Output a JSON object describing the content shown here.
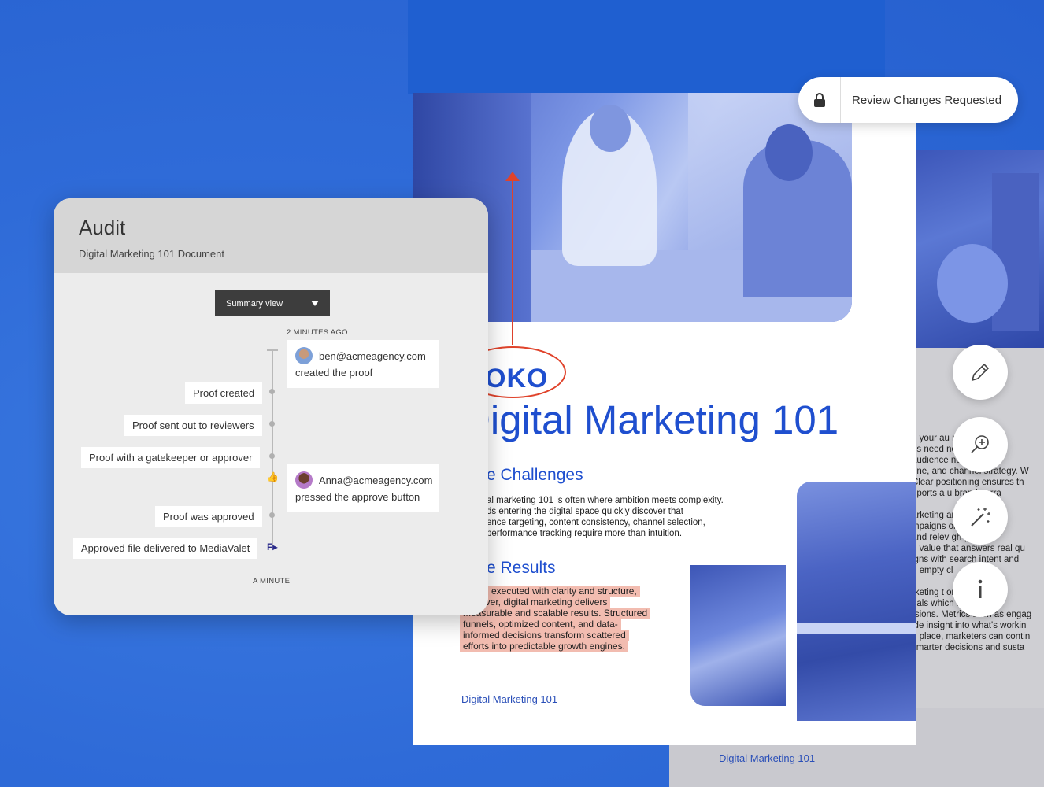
{
  "status": {
    "label": "Review Changes Requested"
  },
  "document": {
    "logo_text": "OKO",
    "title": "Digital Marketing 101",
    "challenges_heading": "e Challenges",
    "challenges_lines": [
      "al marketing 101 is often where ambition meets complexity.",
      "ds entering the digital space quickly discover that",
      "ence targeting, content consistency, channel selection,",
      "performance tracking require more than intuition."
    ],
    "results_heading": "e Results",
    "results_lines": [
      "executed with clarity and structure,",
      "ever, digital marketing delivers",
      "measurable and scalable results. Structured",
      "funnels, optimized content, and data-",
      "informed decisions transform scattered",
      "efforts into predictable growth engines."
    ],
    "footer": "Digital Marketing 101"
  },
  "back_page": {
    "lines": [
      "g your au           re laun",
      "es need             no they",
      "audience            ne online",
      "one, and channel strategy. W",
      " Clear positioning ensures th",
      "pports a u      brand narra",
      "",
      "arketing             articles",
      "mpaigns             ole in bu",
      " and relev        gh-perform",
      "g value that answers real qu",
      "igns with search intent and",
      "h empty cl",
      "",
      "rketing t           ork into",
      "eals which          ns gener",
      "rsions. Metrics such as engag",
      "ide insight into what's workin",
      "n place, marketers can contin",
      "smarter decisions and susta"
    ],
    "footer": "Digital Marketing 101"
  },
  "tools": [
    {
      "icon": "pencil-icon"
    },
    {
      "icon": "zoom-in-icon"
    },
    {
      "icon": "magic-wand-icon"
    },
    {
      "icon": "info-icon"
    }
  ],
  "audit": {
    "title": "Audit",
    "subtitle": "Digital Marketing 101 Document",
    "view_select": "Summary view",
    "time_top": "2 MINUTES AGO",
    "time_bottom": "A MINUTE",
    "events": [
      {
        "label": "Proof created"
      },
      {
        "label": "Proof sent out to reviewers"
      },
      {
        "label": "Proof with a gatekeeper or approver"
      },
      {
        "label": "Proof was approved"
      },
      {
        "label": "Approved file delivered to MediaValet"
      }
    ],
    "cards": [
      {
        "user": "ben@acmeagency.com",
        "action": "created the proof"
      },
      {
        "user": "Anna@acmeagency.com",
        "action": "pressed the approve button"
      }
    ],
    "integration_badge": "F▸"
  }
}
